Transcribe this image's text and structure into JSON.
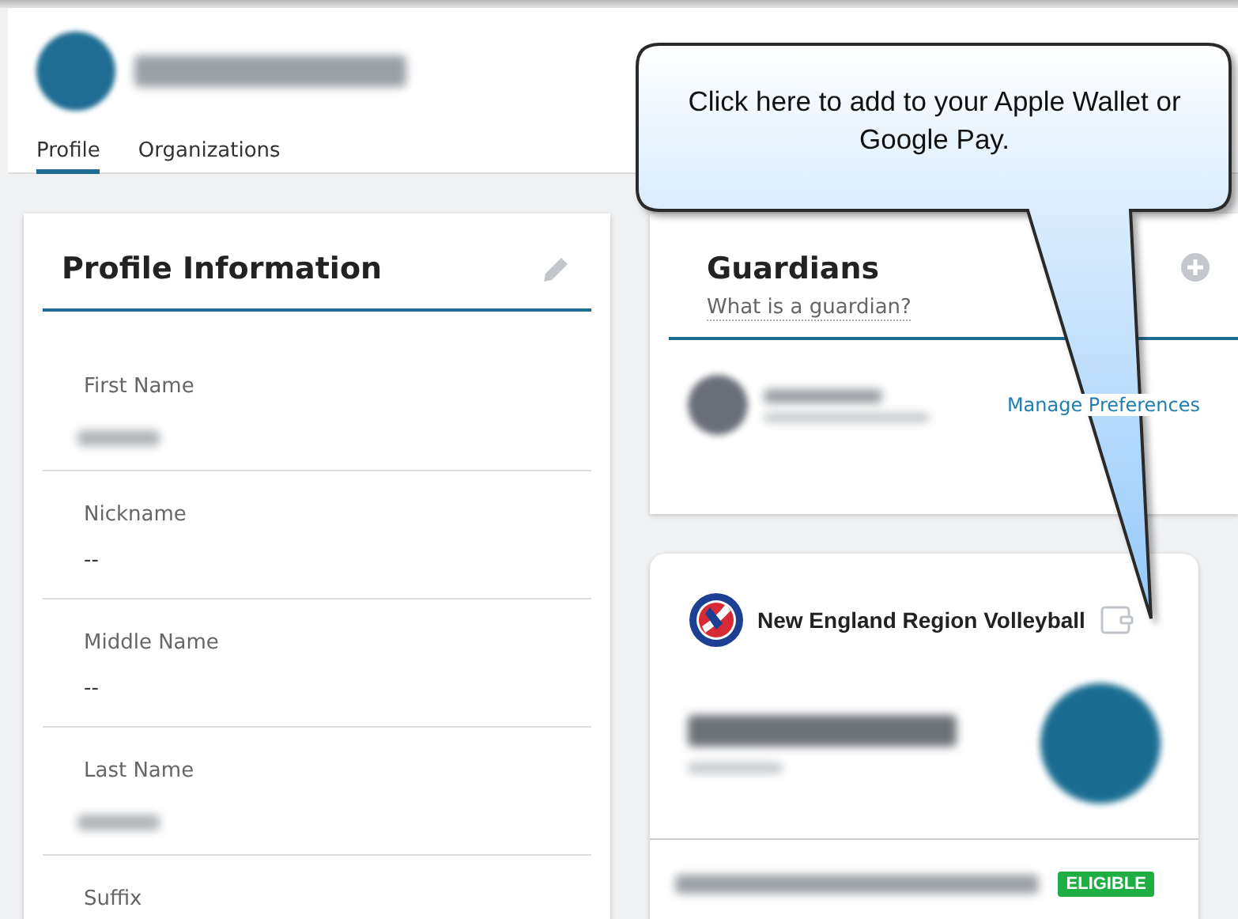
{
  "header": {
    "redacted_name": true,
    "tabs": [
      {
        "label": "Profile",
        "selected": true
      },
      {
        "label": "Organizations",
        "selected": false
      }
    ]
  },
  "profile_card": {
    "title": "Profile Information",
    "fields": [
      {
        "label": "First Name",
        "redacted": true
      },
      {
        "label": "Nickname",
        "value": "--",
        "redacted": false
      },
      {
        "label": "Middle Name",
        "value": "--",
        "redacted": false
      },
      {
        "label": "Last Name",
        "redacted": true
      },
      {
        "label": "Suffix",
        "redacted": false
      }
    ]
  },
  "guardians": {
    "title": "Guardians",
    "help_link": "What is a guardian?",
    "rows": [
      {
        "action": "Manage Preferences"
      }
    ]
  },
  "membership_card": {
    "organization": "New England Region Volleyball",
    "memberships": [
      {
        "status": "ELIGIBLE"
      }
    ]
  },
  "callout": {
    "text": "Click here to add to your Apple Wallet or Google Pay."
  }
}
